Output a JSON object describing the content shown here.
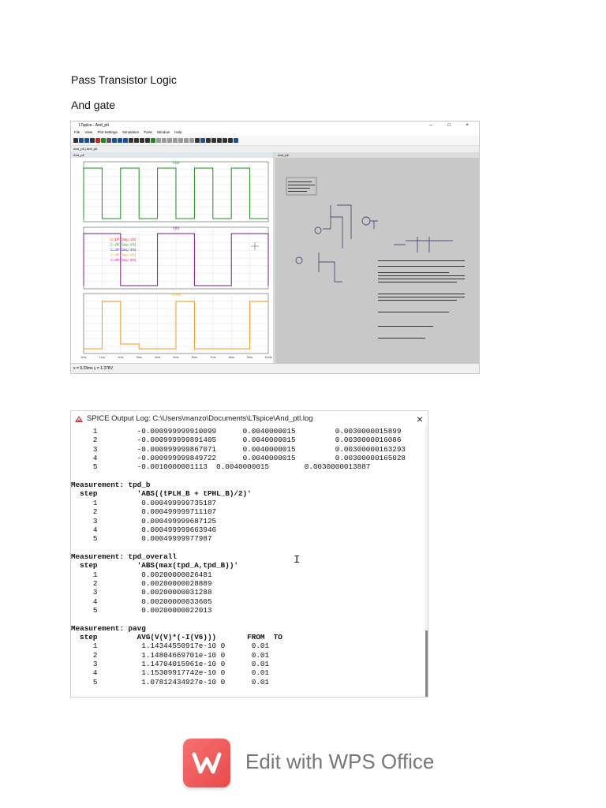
{
  "document": {
    "heading": "Pass Transistor Logic",
    "subheading": "And gate"
  },
  "ltspice": {
    "title": "LTspice - And_ptl",
    "window_controls": "– □ ×",
    "menu": [
      "File",
      "View",
      "Plot Settings",
      "Simulation",
      "Tools",
      "Window",
      "Help"
    ],
    "tabs": "And_ptl  |  And_ptl",
    "plot_window_title": "And_ptl",
    "schematic_window_title": "And_ptl",
    "trace_labels": {
      "top": "V(a)",
      "middle": "V(b)",
      "bottom": "V(out)"
    },
    "step_legend": [
      "C=1fF (Step: 1/5)",
      "C=2fF (Step: 2/5)",
      "C=3fF (Step: 3/5)",
      "C=4fF (Step: 4/5)",
      "C=5fF (Step: 5/5)"
    ],
    "x_ticks": [
      "0ms",
      "1ms",
      "2ms",
      "3ms",
      "4ms",
      "5ms",
      "6ms",
      "7ms",
      "8ms",
      "9ms",
      "10ms"
    ],
    "status": "x = 9.23ms    y = 1.378V",
    "colors": {
      "va": "#1e8f1e",
      "vb": "#7a1a8a",
      "vout": "#f39a1d"
    }
  },
  "spice_log": {
    "title": "SPICE Output Log: C:\\Users\\manzo\\Documents\\LTspice\\And_ptl.log",
    "close": "×",
    "lines": [
      {
        "t": "     1         -0.000999999910099      0.0040000015         0.0030000015899",
        "b": false
      },
      {
        "t": "     2         -0.000999999891405      0.0040000015         0.0030000016086",
        "b": false
      },
      {
        "t": "     3         -0.000999999867071      0.0040000015         0.00300000163293",
        "b": false
      },
      {
        "t": "     4         -0.000999999849722      0.0040000015         0.00300000165028",
        "b": false
      },
      {
        "t": "     5         -0.0010000001113  0.0040000015        0.0030000013887",
        "b": false
      },
      {
        "t": "",
        "b": false
      },
      {
        "t": "Measurement: tpd_b",
        "b": true
      },
      {
        "t": "  step         'ABS((tPLH_B + tPHL_B)/2)'",
        "b": true
      },
      {
        "t": "     1          0.000499999735187",
        "b": false
      },
      {
        "t": "     2          0.000499999711107",
        "b": false
      },
      {
        "t": "     3          0.000499999687125",
        "b": false
      },
      {
        "t": "     4          0.000499999663946",
        "b": false
      },
      {
        "t": "     5          0.00049999977987",
        "b": false
      },
      {
        "t": "",
        "b": false
      },
      {
        "t": "Measurement: tpd_overall",
        "b": true
      },
      {
        "t": "  step         'ABS(max(tpd_A,tpd_B))'",
        "b": true
      },
      {
        "t": "     1          0.00200000026481",
        "b": false
      },
      {
        "t": "     2          0.00200000028889",
        "b": false
      },
      {
        "t": "     3          0.00200000031288",
        "b": false
      },
      {
        "t": "     4          0.00200000033605",
        "b": false
      },
      {
        "t": "     5          0.00200000022013",
        "b": false
      },
      {
        "t": "",
        "b": false
      },
      {
        "t": "Measurement: pavg",
        "b": true
      },
      {
        "t": "  step         AVG(V(V)*(-I(V6)))       FROM  TO",
        "b": true
      },
      {
        "t": "     1          1.14344550917e-10 0      0.01",
        "b": false
      },
      {
        "t": "     2          1.14804669701e-10 0      0.01",
        "b": false
      },
      {
        "t": "     3          1.14704015961e-10 0      0.01",
        "b": false
      },
      {
        "t": "     4          1.15309917742e-10 0      0.01",
        "b": false
      },
      {
        "t": "     5          1.07812434927e-10 0      0.01",
        "b": false
      }
    ]
  },
  "cursor": "I",
  "wps": {
    "label": "Edit with WPS Office",
    "colors": {
      "logo": "#ee5a5a"
    }
  }
}
